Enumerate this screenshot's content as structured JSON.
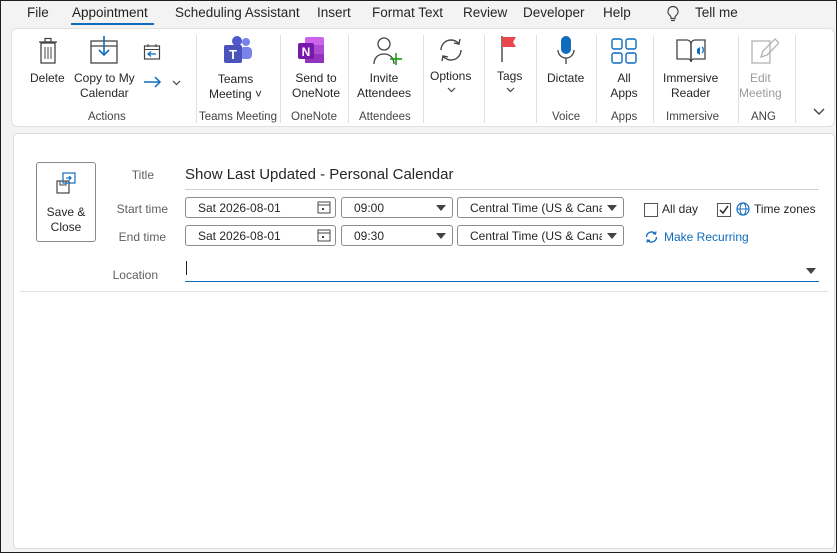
{
  "menu": {
    "tabs": [
      "File",
      "Appointment",
      "Scheduling Assistant",
      "Insert",
      "Format Text",
      "Review",
      "Developer",
      "Help"
    ],
    "active_tab": "Appointment",
    "tell_me": "Tell me"
  },
  "ribbon": {
    "delete": "Delete",
    "copy_to_calendar": "Copy to My\nCalendar",
    "actions_group": "Actions",
    "teams_meeting": "Teams\nMeeting ˅",
    "teams_group": "Teams Meeting",
    "send_to_onenote": "Send to\nOneNote",
    "onenote_group": "OneNote",
    "invite_attendees": "Invite\nAttendees",
    "attendees_group": "Attendees",
    "options": "Options",
    "tags": "Tags",
    "dictate": "Dictate",
    "voice_group": "Voice",
    "all_apps": "All\nApps",
    "apps_group": "Apps",
    "immersive_reader": "Immersive\nReader",
    "immersive_group": "Immersive",
    "edit_meeting": "Edit\nMeeting",
    "ang_group": "ANG",
    "colors": {
      "teams": "#5059c9",
      "onenote": "#7719aa",
      "accent": "#0f6cbd",
      "tag_red": "#e8474b"
    }
  },
  "form": {
    "save_close": "Save &\nClose",
    "title_label": "Title",
    "title_value": "Show Last Updated - Personal Calendar",
    "start_label": "Start time",
    "end_label": "End time",
    "start_date": "Sat 2026-08-01",
    "start_time": "09:00",
    "start_tz": "Central Time (US & Canada)",
    "end_date": "Sat 2026-08-01",
    "end_time": "09:30",
    "end_tz": "Central Time (US & Canada)",
    "all_day_label": "All day",
    "all_day_checked": false,
    "time_zones_label": "Time zones",
    "time_zones_checked": true,
    "make_recurring": "Make Recurring",
    "location_label": "Location",
    "location_value": ""
  }
}
